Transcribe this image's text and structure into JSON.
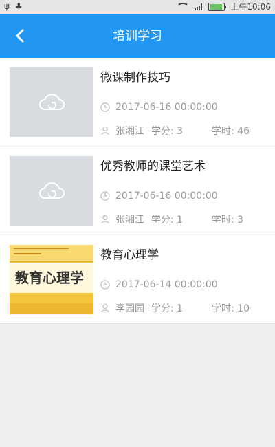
{
  "status_bar": {
    "time": "上午10:06",
    "battery_level": 0.86
  },
  "header": {
    "title": "培训学习"
  },
  "courses": [
    {
      "title": "微课制作技巧",
      "date": "2017-06-16 00:00:00",
      "author": "张湘江",
      "credit": "学分: 3",
      "hours": "学时: 46"
    },
    {
      "title": "优秀教师的课堂艺术",
      "date": "2017-06-16 00:00:00",
      "author": "张湘江",
      "credit": "学分: 1",
      "hours": "学时: 3"
    },
    {
      "title": "教育心理学",
      "date": "2017-06-14 00:00:00",
      "author": "李园园",
      "credit": "学分: 1",
      "hours": "学时: 10",
      "cover_text": "教育心理学"
    }
  ]
}
